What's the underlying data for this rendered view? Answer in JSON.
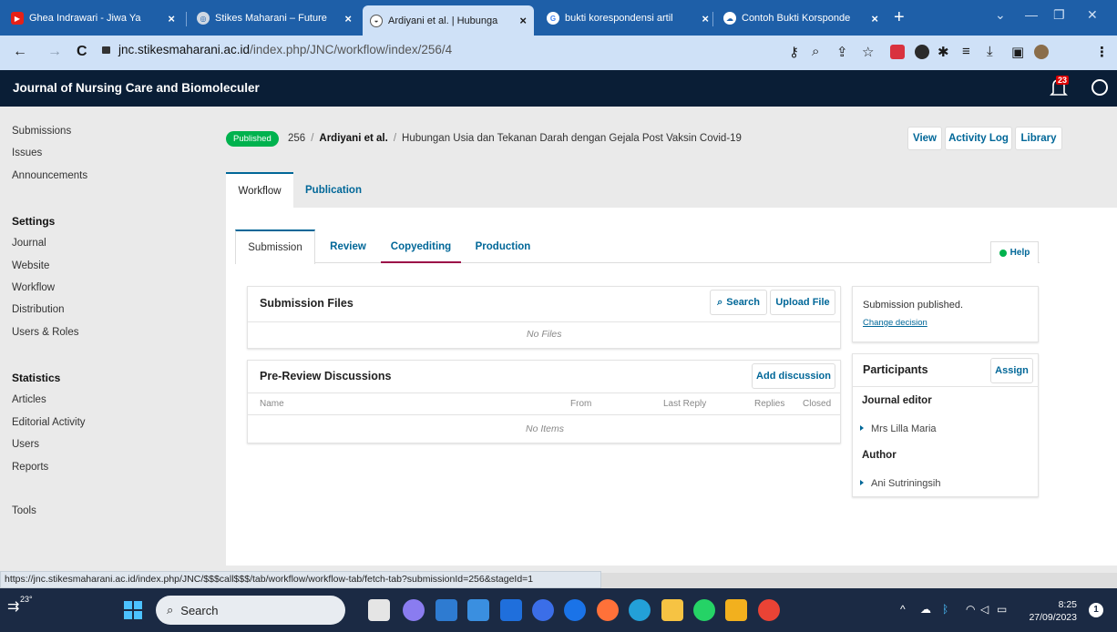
{
  "browser": {
    "tabs": [
      {
        "title": "Ghea Indrawari - Jiwa Ya",
        "icon": "youtube-icon"
      },
      {
        "title": "Stikes Maharani – Future",
        "icon": "globe-icon"
      },
      {
        "title": "Ardiyani et al. | Hubunga",
        "icon": "ojs-icon",
        "active": true
      },
      {
        "title": "bukti korespondensi artil",
        "icon": "google-icon"
      },
      {
        "title": "Contoh Bukti Korsponde",
        "icon": "cloud-icon"
      }
    ],
    "url_host": "jnc.stikesmaharani.ac.id",
    "url_path": "/index.php/JNC/workflow/index/256/4"
  },
  "header": {
    "journal_name": "Journal of Nursing Care and Biomoleculer",
    "notification_count": "23"
  },
  "sidebar": {
    "top_links": [
      "Submissions",
      "Issues",
      "Announcements"
    ],
    "settings_heading": "Settings",
    "settings_links": [
      "Journal",
      "Website",
      "Workflow",
      "Distribution",
      "Users & Roles"
    ],
    "statistics_heading": "Statistics",
    "statistics_links": [
      "Articles",
      "Editorial Activity",
      "Users",
      "Reports"
    ],
    "tools": "Tools"
  },
  "submission": {
    "status": "Published",
    "id": "256",
    "authors": "Ardiyani et al.",
    "title": "Hubungan Usia dan Tekanan Darah dengan Gejala Post Vaksin Covid-19",
    "actions": {
      "view": "View",
      "activity_log": "Activity Log",
      "library": "Library"
    }
  },
  "page_tabs": {
    "workflow": "Workflow",
    "publication": "Publication"
  },
  "stage_tabs": {
    "submission": "Submission",
    "review": "Review",
    "copyediting": "Copyediting",
    "production": "Production"
  },
  "help": "Help",
  "files": {
    "title": "Submission Files",
    "search": "Search",
    "upload": "Upload File",
    "empty": "No Files"
  },
  "discussions": {
    "title": "Pre-Review Discussions",
    "add": "Add discussion",
    "columns": [
      "Name",
      "From",
      "Last Reply",
      "Replies",
      "Closed"
    ],
    "empty": "No Items"
  },
  "decision": {
    "text": "Submission published.",
    "change": "Change decision"
  },
  "participants": {
    "title": "Participants",
    "assign": "Assign",
    "groups": [
      {
        "role": "Journal editor",
        "name": "Mrs Lilla Maria"
      },
      {
        "role": "Author",
        "name": "Ani Sutriningsih"
      }
    ]
  },
  "status_url": "https://jnc.stikesmaharani.ac.id/index.php/JNC/$$$call$$$/tab/workflow/workflow-tab/fetch-tab?submissionId=256&stageId=1",
  "taskbar": {
    "weather": "23°",
    "search": "Search",
    "time": "8:25",
    "date": "27/09/2023"
  },
  "colors": {
    "accent": "#006798",
    "header_bg": "#0a1e36",
    "published_badge": "#00b24e",
    "copyediting_underline": "#9b0a47",
    "browser_chrome": "#1e5fa8"
  }
}
